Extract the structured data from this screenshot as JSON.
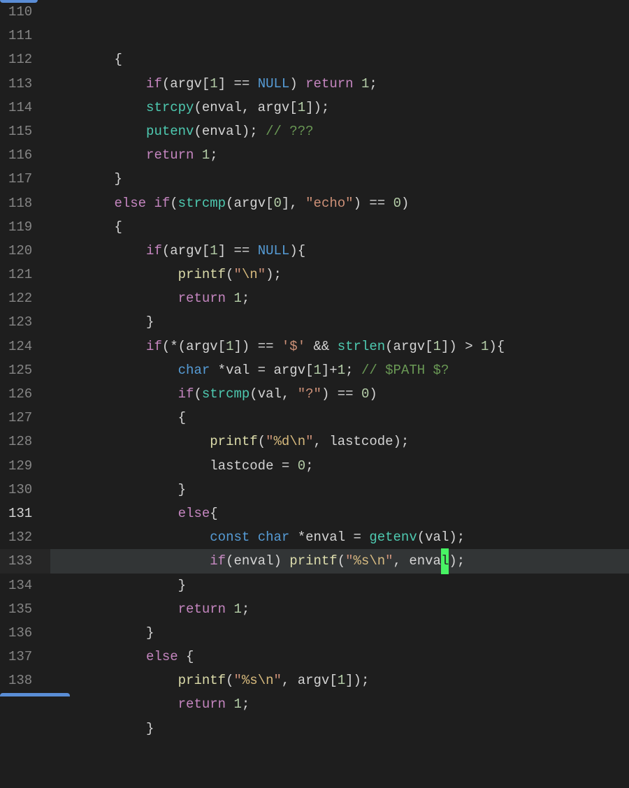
{
  "editor": {
    "startLine": 110,
    "activeLine": 131,
    "lines": [
      {
        "n": 110,
        "indent": 8,
        "tokens": [
          {
            "t": "{",
            "c": "punct"
          }
        ]
      },
      {
        "n": 111,
        "indent": 12,
        "tokens": [
          {
            "t": "if",
            "c": "control"
          },
          {
            "t": "(argv[",
            "c": "punct"
          },
          {
            "t": "1",
            "c": "number"
          },
          {
            "t": "] == ",
            "c": "op"
          },
          {
            "t": "NULL",
            "c": "const"
          },
          {
            "t": ") ",
            "c": "punct"
          },
          {
            "t": "return",
            "c": "control"
          },
          {
            "t": " ",
            "c": "op"
          },
          {
            "t": "1",
            "c": "number"
          },
          {
            "t": ";",
            "c": "punct"
          }
        ]
      },
      {
        "n": 112,
        "indent": 12,
        "tokens": [
          {
            "t": "strcpy",
            "c": "func"
          },
          {
            "t": "(enval, argv[",
            "c": "punct"
          },
          {
            "t": "1",
            "c": "number"
          },
          {
            "t": "]);",
            "c": "punct"
          }
        ]
      },
      {
        "n": 113,
        "indent": 12,
        "tokens": [
          {
            "t": "putenv",
            "c": "func"
          },
          {
            "t": "(enval); ",
            "c": "punct"
          },
          {
            "t": "// ???",
            "c": "comment"
          }
        ]
      },
      {
        "n": 114,
        "indent": 12,
        "tokens": [
          {
            "t": "return",
            "c": "control"
          },
          {
            "t": " ",
            "c": "op"
          },
          {
            "t": "1",
            "c": "number"
          },
          {
            "t": ";",
            "c": "punct"
          }
        ]
      },
      {
        "n": 115,
        "indent": 8,
        "tokens": [
          {
            "t": "}",
            "c": "punct"
          }
        ]
      },
      {
        "n": 116,
        "indent": 8,
        "tokens": [
          {
            "t": "else",
            "c": "control"
          },
          {
            "t": " ",
            "c": "op"
          },
          {
            "t": "if",
            "c": "control"
          },
          {
            "t": "(",
            "c": "punct"
          },
          {
            "t": "strcmp",
            "c": "func"
          },
          {
            "t": "(argv[",
            "c": "punct"
          },
          {
            "t": "0",
            "c": "number"
          },
          {
            "t": "], ",
            "c": "punct"
          },
          {
            "t": "\"echo\"",
            "c": "string"
          },
          {
            "t": ") == ",
            "c": "op"
          },
          {
            "t": "0",
            "c": "number"
          },
          {
            "t": ")",
            "c": "punct"
          }
        ]
      },
      {
        "n": 117,
        "indent": 8,
        "tokens": [
          {
            "t": "{",
            "c": "punct"
          }
        ]
      },
      {
        "n": 118,
        "indent": 12,
        "tokens": [
          {
            "t": "if",
            "c": "control"
          },
          {
            "t": "(argv[",
            "c": "punct"
          },
          {
            "t": "1",
            "c": "number"
          },
          {
            "t": "] == ",
            "c": "op"
          },
          {
            "t": "NULL",
            "c": "const"
          },
          {
            "t": "){",
            "c": "punct"
          }
        ]
      },
      {
        "n": 119,
        "indent": 16,
        "tokens": [
          {
            "t": "printf",
            "c": "funcname"
          },
          {
            "t": "(",
            "c": "punct"
          },
          {
            "t": "\"",
            "c": "string"
          },
          {
            "t": "\\n",
            "c": "escape"
          },
          {
            "t": "\"",
            "c": "string"
          },
          {
            "t": ");",
            "c": "punct"
          }
        ]
      },
      {
        "n": 120,
        "indent": 16,
        "tokens": [
          {
            "t": "return",
            "c": "control"
          },
          {
            "t": " ",
            "c": "op"
          },
          {
            "t": "1",
            "c": "number"
          },
          {
            "t": ";",
            "c": "punct"
          }
        ]
      },
      {
        "n": 121,
        "indent": 12,
        "tokens": [
          {
            "t": "}",
            "c": "punct"
          }
        ]
      },
      {
        "n": 122,
        "indent": 12,
        "tokens": [
          {
            "t": "if",
            "c": "control"
          },
          {
            "t": "(*(argv[",
            "c": "punct"
          },
          {
            "t": "1",
            "c": "number"
          },
          {
            "t": "]) == ",
            "c": "op"
          },
          {
            "t": "'$'",
            "c": "char"
          },
          {
            "t": " && ",
            "c": "op"
          },
          {
            "t": "strlen",
            "c": "func"
          },
          {
            "t": "(argv[",
            "c": "punct"
          },
          {
            "t": "1",
            "c": "number"
          },
          {
            "t": "]) > ",
            "c": "op"
          },
          {
            "t": "1",
            "c": "number"
          },
          {
            "t": "){",
            "c": "punct"
          }
        ]
      },
      {
        "n": 123,
        "indent": 16,
        "tokens": [
          {
            "t": "char",
            "c": "type"
          },
          {
            "t": " *val = argv[",
            "c": "op"
          },
          {
            "t": "1",
            "c": "number"
          },
          {
            "t": "]+",
            "c": "op"
          },
          {
            "t": "1",
            "c": "number"
          },
          {
            "t": "; ",
            "c": "punct"
          },
          {
            "t": "// $PATH $?",
            "c": "comment"
          }
        ]
      },
      {
        "n": 124,
        "indent": 16,
        "tokens": [
          {
            "t": "if",
            "c": "control"
          },
          {
            "t": "(",
            "c": "punct"
          },
          {
            "t": "strcmp",
            "c": "func"
          },
          {
            "t": "(val, ",
            "c": "punct"
          },
          {
            "t": "\"?\"",
            "c": "string"
          },
          {
            "t": ") == ",
            "c": "op"
          },
          {
            "t": "0",
            "c": "number"
          },
          {
            "t": ")",
            "c": "punct"
          }
        ]
      },
      {
        "n": 125,
        "indent": 16,
        "tokens": [
          {
            "t": "{",
            "c": "punct"
          }
        ]
      },
      {
        "n": 126,
        "indent": 20,
        "tokens": [
          {
            "t": "printf",
            "c": "funcname"
          },
          {
            "t": "(",
            "c": "punct"
          },
          {
            "t": "\"",
            "c": "string"
          },
          {
            "t": "%d\\n",
            "c": "escape"
          },
          {
            "t": "\"",
            "c": "string"
          },
          {
            "t": ", lastcode);",
            "c": "punct"
          }
        ]
      },
      {
        "n": 127,
        "indent": 20,
        "tokens": [
          {
            "t": "lastcode = ",
            "c": "op"
          },
          {
            "t": "0",
            "c": "number"
          },
          {
            "t": ";",
            "c": "punct"
          }
        ]
      },
      {
        "n": 128,
        "indent": 16,
        "tokens": [
          {
            "t": "}",
            "c": "punct"
          }
        ]
      },
      {
        "n": 129,
        "indent": 16,
        "tokens": [
          {
            "t": "else",
            "c": "control"
          },
          {
            "t": "{",
            "c": "punct"
          }
        ]
      },
      {
        "n": 130,
        "indent": 20,
        "tokens": [
          {
            "t": "const",
            "c": "type"
          },
          {
            "t": " ",
            "c": "op"
          },
          {
            "t": "char",
            "c": "type"
          },
          {
            "t": " *enval = ",
            "c": "op"
          },
          {
            "t": "getenv",
            "c": "func"
          },
          {
            "t": "(val);",
            "c": "punct"
          }
        ]
      },
      {
        "n": 131,
        "indent": 20,
        "highlight": true,
        "tokens": [
          {
            "t": "if",
            "c": "control"
          },
          {
            "t": "(enval) ",
            "c": "punct"
          },
          {
            "t": "printf",
            "c": "funcname"
          },
          {
            "t": "(",
            "c": "punct"
          },
          {
            "t": "\"",
            "c": "string"
          },
          {
            "t": "%s\\n",
            "c": "escape"
          },
          {
            "t": "\"",
            "c": "string"
          },
          {
            "t": ", enva",
            "c": "punct"
          },
          {
            "t": "l",
            "c": "cursor"
          },
          {
            "t": ");",
            "c": "punct"
          }
        ]
      },
      {
        "n": 132,
        "indent": 16,
        "tokens": [
          {
            "t": "}",
            "c": "punct"
          }
        ]
      },
      {
        "n": 133,
        "indent": 16,
        "tokens": [
          {
            "t": "return",
            "c": "control"
          },
          {
            "t": " ",
            "c": "op"
          },
          {
            "t": "1",
            "c": "number"
          },
          {
            "t": ";",
            "c": "punct"
          }
        ]
      },
      {
        "n": 134,
        "indent": 12,
        "tokens": [
          {
            "t": "}",
            "c": "punct"
          }
        ]
      },
      {
        "n": 135,
        "indent": 12,
        "tokens": [
          {
            "t": "else",
            "c": "control"
          },
          {
            "t": " {",
            "c": "punct"
          }
        ]
      },
      {
        "n": 136,
        "indent": 16,
        "tokens": [
          {
            "t": "printf",
            "c": "funcname"
          },
          {
            "t": "(",
            "c": "punct"
          },
          {
            "t": "\"",
            "c": "string"
          },
          {
            "t": "%s\\n",
            "c": "escape"
          },
          {
            "t": "\"",
            "c": "string"
          },
          {
            "t": ", argv[",
            "c": "punct"
          },
          {
            "t": "1",
            "c": "number"
          },
          {
            "t": "]);",
            "c": "punct"
          }
        ]
      },
      {
        "n": 137,
        "indent": 16,
        "tokens": [
          {
            "t": "return",
            "c": "control"
          },
          {
            "t": " ",
            "c": "op"
          },
          {
            "t": "1",
            "c": "number"
          },
          {
            "t": ";",
            "c": "punct"
          }
        ]
      },
      {
        "n": 138,
        "indent": 12,
        "tokens": [
          {
            "t": "}",
            "c": "punct"
          }
        ]
      }
    ]
  }
}
